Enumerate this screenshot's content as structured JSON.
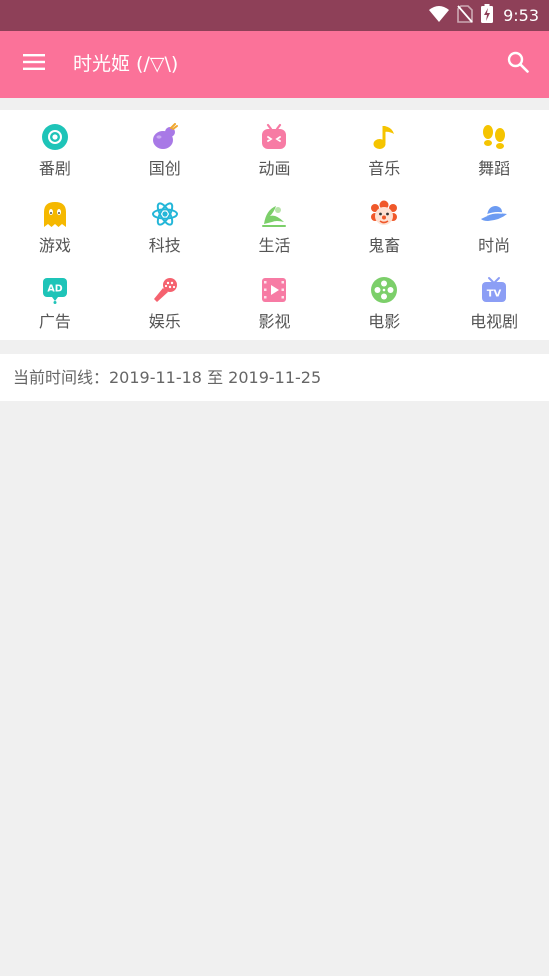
{
  "status_bar": {
    "time": "9:53",
    "icons": [
      "wifi-icon",
      "no-sim-icon",
      "battery-charging-icon"
    ]
  },
  "app_bar": {
    "title": "时光姬 (/▽\\)",
    "left_icon": "menu-icon",
    "right_icon": "search-icon",
    "color": "#fb7299"
  },
  "categories": [
    {
      "label": "番剧",
      "icon": "bangumi-icon",
      "color": "#1ec4b8"
    },
    {
      "label": "国创",
      "icon": "guochuang-icon",
      "color": "#a879e6"
    },
    {
      "label": "动画",
      "icon": "douga-icon",
      "color": "#f77ba4"
    },
    {
      "label": "音乐",
      "icon": "music-note-icon",
      "color": "#f5c400"
    },
    {
      "label": "舞蹈",
      "icon": "footprints-icon",
      "color": "#f5c400"
    },
    {
      "label": "游戏",
      "icon": "ghost-icon",
      "color": "#f5b800"
    },
    {
      "label": "科技",
      "icon": "atom-icon",
      "color": "#23b6d8"
    },
    {
      "label": "生活",
      "icon": "life-icon",
      "color": "#7ccf6a"
    },
    {
      "label": "鬼畜",
      "icon": "clown-icon",
      "color": "#f0582a"
    },
    {
      "label": "时尚",
      "icon": "hat-icon",
      "color": "#6c9bf2"
    },
    {
      "label": "广告",
      "icon": "ad-icon",
      "color": "#1ec4b8"
    },
    {
      "label": "娱乐",
      "icon": "microphone-icon",
      "color": "#f5626f"
    },
    {
      "label": "影视",
      "icon": "film-icon",
      "color": "#f77ba4"
    },
    {
      "label": "电影",
      "icon": "film-reel-icon",
      "color": "#7ccf6a"
    },
    {
      "label": "电视剧",
      "icon": "tv-icon",
      "color": "#8c9ef5"
    }
  ],
  "timeline": {
    "text": "当前时间线：2019-11-18 至 2019-11-25"
  }
}
